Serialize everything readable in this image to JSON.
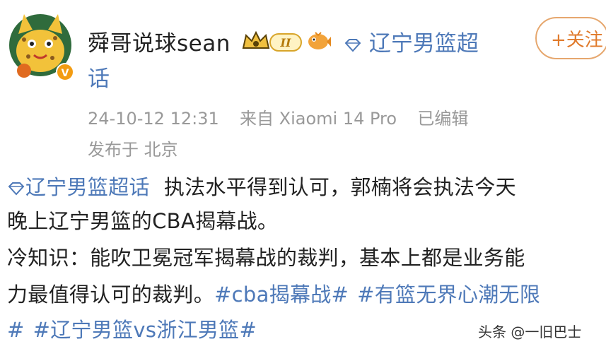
{
  "header": {
    "username": "舜哥说球sean",
    "topic_prefix": "辽宁男篮超",
    "topic_suffix": "话",
    "follow_label": "+关注",
    "vip_level": "II"
  },
  "meta": {
    "timestamp": "24-10-12 12:31",
    "source": "来自 Xiaomi 14 Pro",
    "edited": "已编辑",
    "location": "发布于 北京"
  },
  "post": {
    "topic_link": "辽宁男篮超话",
    "line1_text": "执法水平得到认可，郭楠将会执法今天",
    "line2_text": "晚上辽宁男篮的CBA揭幕战。",
    "line3_text": "冷知识：能吹卫冕冠军揭幕战的裁判，基本上都是业务能",
    "line4_text": "力最值得认可的裁判。",
    "hashtag1": "#cba揭幕战#",
    "hashtag2_start": "#有篮无界心潮无限",
    "hashtag2_end": "#",
    "hashtag3": "#辽宁男篮vs浙江男篮#"
  },
  "watermark": "头条 @一旧巴士",
  "colors": {
    "link": "#4e79b8",
    "follow": "#e07a2b",
    "meta": "#999999"
  }
}
